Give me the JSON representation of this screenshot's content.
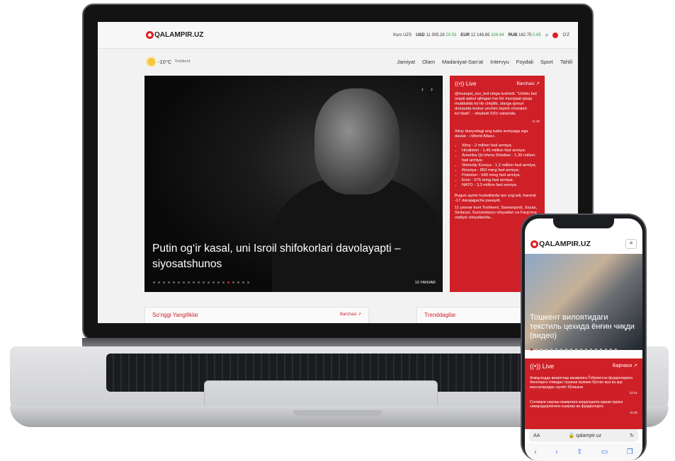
{
  "site": {
    "logo": "QALAMPIR.UZ",
    "kurs_label": "Kurs UZS",
    "rates": [
      {
        "code": "USD",
        "value": "11 305.28",
        "change": "20.53"
      },
      {
        "code": "EUR",
        "value": "12 148.65",
        "change": "104.44"
      },
      {
        "code": "RUB",
        "value": "162.75",
        "change": "0.65"
      }
    ],
    "lang": "O‘Z",
    "weather": {
      "temp": "-10°C",
      "city": "Toshkent"
    },
    "menu": [
      "Jamiyat",
      "Olam",
      "Madaniyat-San'at",
      "Intervyu",
      "Foydali",
      "Sport",
      "Tahlil"
    ],
    "hero": {
      "title": "Putin og‘ir kasal, uni Isroil shifokorlari davolayapti – siyosatshunos",
      "date": "10 YANVAR"
    },
    "live": {
      "label": "Live",
      "all": "Barchasi ↗",
      "p1": "@murojat_ssv_bot ishga tushirdi. \"Ushbu bot orqali qabul qilingan har bir murojaat qisqa muddatda ko‘rib chiqilib, ularga qonun doirasida tezkor yechim topish choralari ko‘riladi\", - deyiladi SSV xabarida.",
      "t1": "11:30",
      "p2": "Xitoy dunyodagi eng katta armiyaga ega davlat - «World Atlas».",
      "list": [
        "Xitoy - 2 million faol armiya;",
        "Hindiston - 1,45 million faol armiya;",
        "Amerika Qo‘shma Shtatlari - 1,39 million faol armiya;",
        "Shimoliy Koreya - 1,2 million faol armiya;",
        "Rossiya - 850 ming faol armiya;",
        "Pokiston - 640 ming faol armiya;",
        "Eron - 575 ming faol armiya;",
        "NATO - 3,3 million faol armiya."
      ],
      "p3": "Bugun ayrim hududlarda qor yog‘adi, harorat -17 darajagacha pasaydi.",
      "p4": "11 yanvar kuni Toshkent, Samarqand, Jizzax, Sirdaryo, Surxondaryo viloyatlari va Farg‘ona vodiysi viloyatlarida..."
    },
    "latest": {
      "title": "So‘nggi Yangiliklar",
      "more": "Barchasi ↗"
    },
    "trending": {
      "title": "Trenddagilar"
    }
  },
  "phone": {
    "logo": "QALAMPIR.UZ",
    "hero_title": "Тошкент вилоятидаги текстиль цехида ёнғин чиқди (видео)",
    "live_label": "Live",
    "live_all": "Барчаси ↗",
    "item1": "Фавқулодда вазиятлар вазирлиги Ўзбекистон фуқароларига биноларга томидан тушиши мумкин бўлган муз ва қор массаларидан эҳтиёт бўлишни",
    "item1_time": "12:41",
    "item2": "Соғлиқни сақлаш вазирлиги коррупцияга қарши кураш самарадорлигини ошириш ва фуқароларга",
    "item2_time": "11:32",
    "url_aa": "AA",
    "url": "qalampir.uz",
    "reload": "↻",
    "nav": [
      "‹",
      "›",
      "⇧",
      "▭",
      "❐"
    ]
  }
}
